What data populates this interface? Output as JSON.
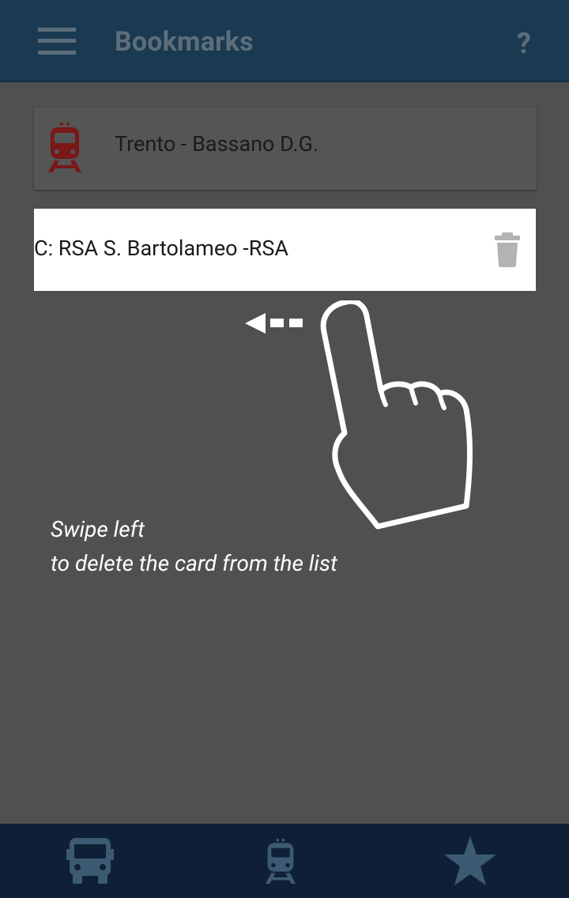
{
  "appbar": {
    "title": "Bookmarks",
    "menu_icon": "menu-icon",
    "help_label": "?"
  },
  "bookmarks": [
    {
      "icon": "train-icon",
      "label": "Trento - Bassano D.G.",
      "icon_color": "#7a1717"
    },
    {
      "label": "C: RSA S. Bartolameo -RSA",
      "action_icon": "trash-icon"
    }
  ],
  "tutorial": {
    "line1": "Swipe left",
    "line2": "to delete the card from the list",
    "gesture_icon": "pointing-hand-icon",
    "arrow_icon": "left-arrow-icon"
  },
  "bottom_nav": [
    {
      "icon": "bus-icon"
    },
    {
      "icon": "train-icon"
    },
    {
      "icon": "star-icon"
    }
  ],
  "colors": {
    "appbar": "#1a3a52",
    "overlay_background": "#505050",
    "bottom_nav": "#0f2036",
    "nav_icon": "#3c5a72",
    "train_icon": "#7a1717"
  }
}
